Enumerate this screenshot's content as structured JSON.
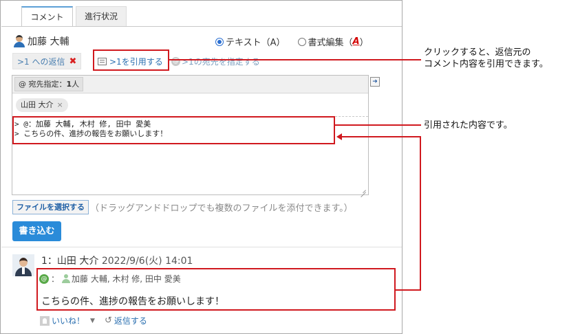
{
  "tabs": [
    {
      "label": "コメント",
      "active": true
    },
    {
      "label": "進行状況",
      "active": false
    }
  ],
  "composer": {
    "author": "加藤 大輔",
    "format_text": "テキスト（A）",
    "format_rich": "書式編集（",
    "format_rich_icon": "A",
    "format_rich_close": "）",
    "reply_to": ">1 への返信",
    "reply_remove": "✖",
    "quote_link": ">1を引用する",
    "dest_link": ">1の宛先を指定する",
    "dest_label": "宛先指定：",
    "dest_count": "1",
    "dest_unit": "人",
    "recipient_chip": "山田 大介",
    "chip_remove": "×",
    "quote_line1": "> @：加藤 大輔, 木村 修, 田中 愛美",
    "quote_line2": "> こちらの件、進捗の報告をお願いします！",
    "file_button": "ファイルを選択する",
    "file_hint": "（ドラッグアンドドロップでも複数のファイルを添付できます。）",
    "submit": "書き込む"
  },
  "post": {
    "number": "1：",
    "author": "山田 大介",
    "datetime": "2022/9/6(火) 14:01",
    "dest_prefix": "：",
    "recipients": "加藤 大輔, 木村 修, 田中 愛美",
    "body": "こちらの件、進捗の報告をお願いします！",
    "like": "いいね！",
    "reply": "返信する"
  },
  "annotations": {
    "callout_top_line1": "クリックすると、返信元の",
    "callout_top_line2": "コメント内容を引用できます。",
    "callout_mid": "引用された内容です。"
  },
  "colors": {
    "accent": "#2a8bd9",
    "highlight": "#d0181e",
    "link": "#2a6fb0"
  }
}
